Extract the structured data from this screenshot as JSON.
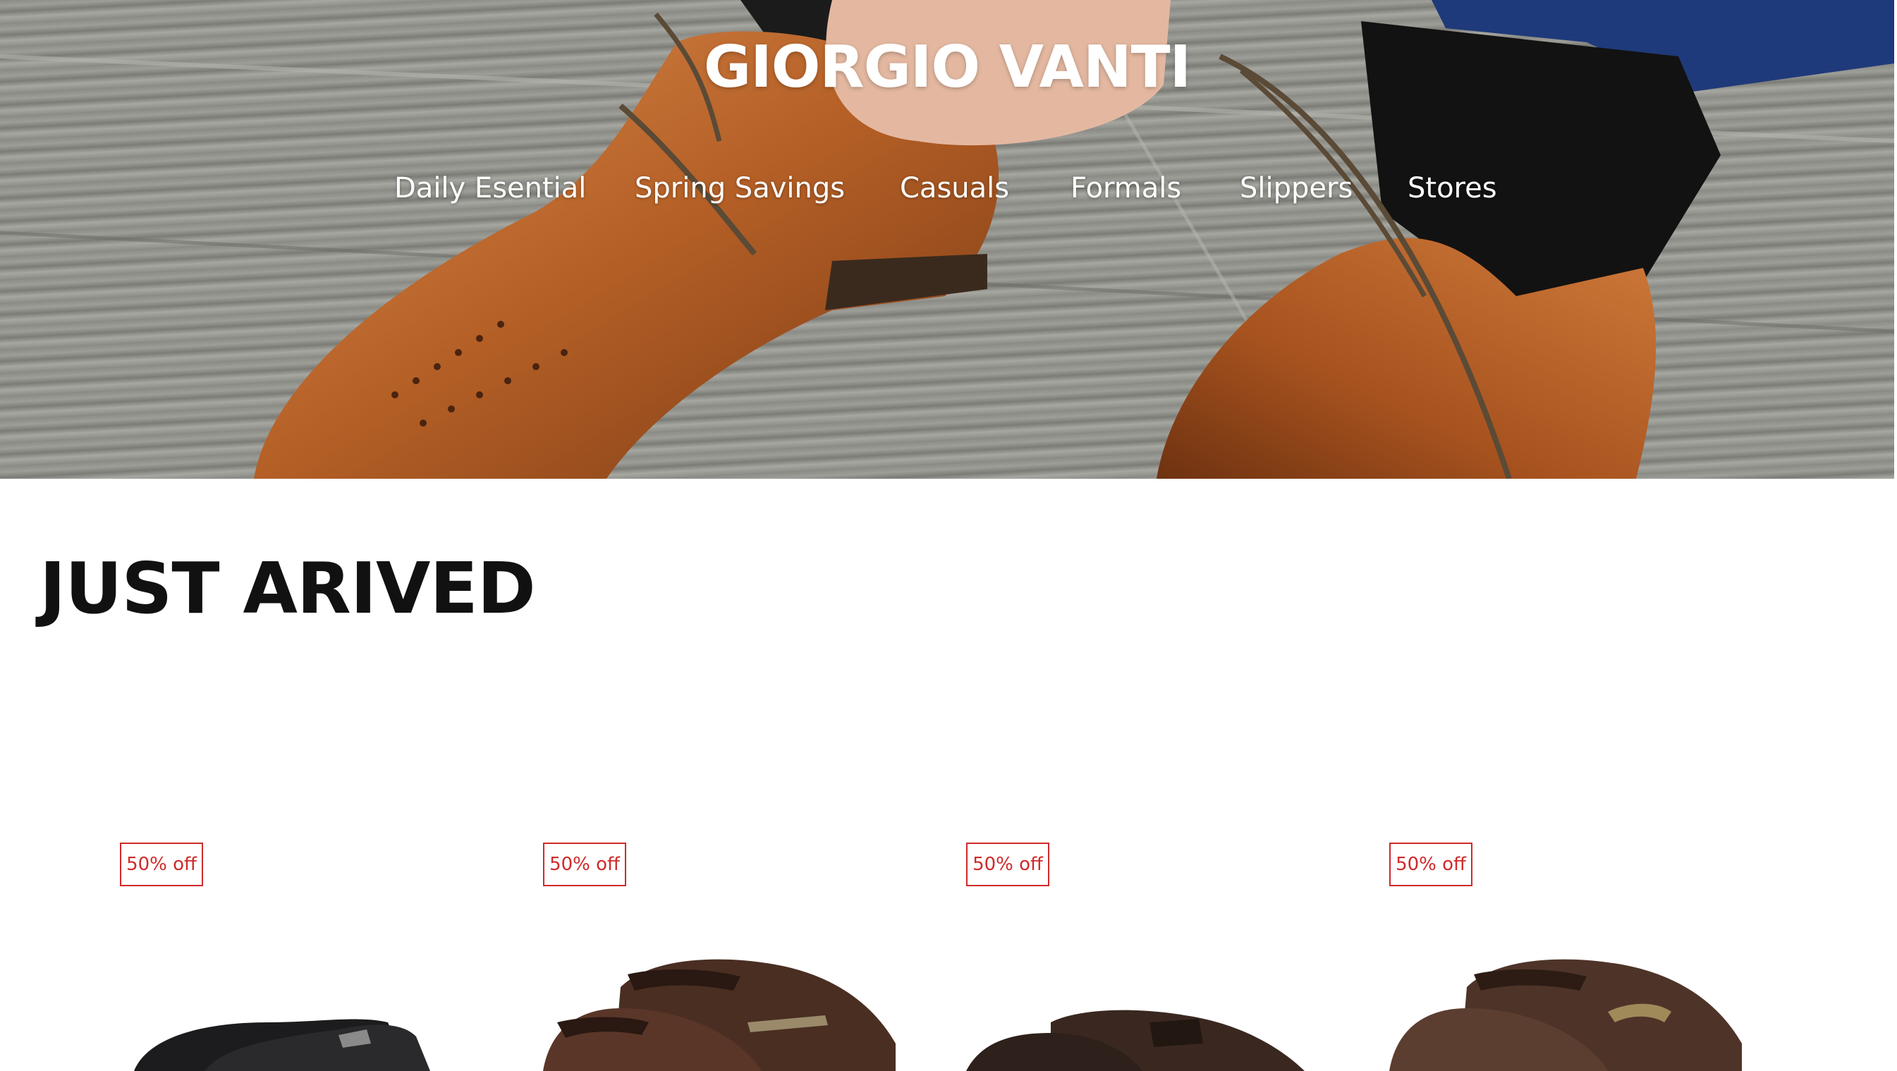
{
  "brand": {
    "name": "GIORGIO VANTI"
  },
  "nav": {
    "items": [
      "Daily Esential",
      "Spring Savings",
      "Casuals",
      "Formals",
      "Slippers",
      "Stores"
    ]
  },
  "section": {
    "title": "JUST ARIVED"
  },
  "products": [
    {
      "badge": "50% off"
    },
    {
      "badge": "50% off"
    },
    {
      "badge": "50% off"
    },
    {
      "badge": "50% off"
    }
  ],
  "colors": {
    "badge": "#cf2a2a",
    "title": "#111111",
    "nav_text": "#ffffff",
    "leather": "#b0602a",
    "floor": "#8f8f89"
  }
}
